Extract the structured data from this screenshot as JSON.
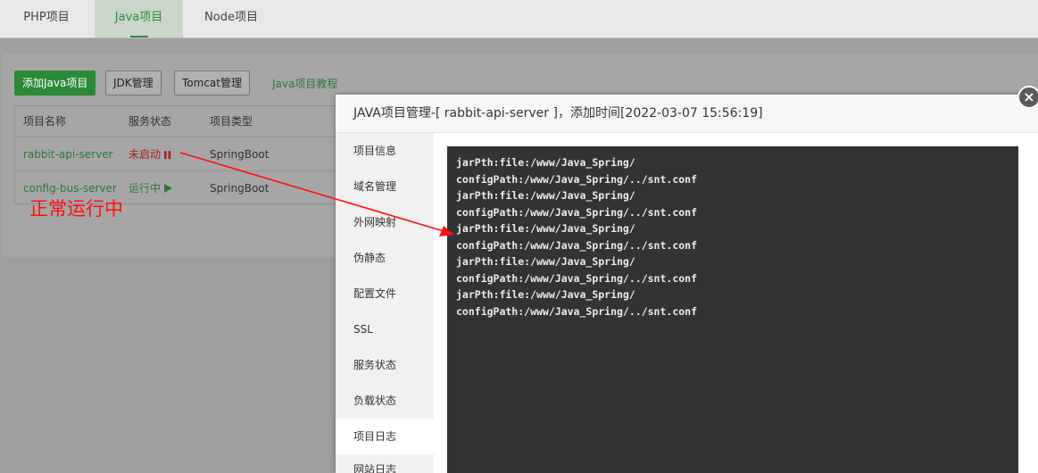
{
  "tabs": [
    {
      "label": "PHP项目"
    },
    {
      "label": "Java项目"
    },
    {
      "label": "Node项目"
    }
  ],
  "toolbar": {
    "add_label": "添加Java项目",
    "jdk_label": "JDK管理",
    "tomcat_label": "Tomcat管理",
    "tutorial_label": "Java项目教程"
  },
  "table": {
    "headers": [
      "项目名称",
      "服务状态",
      "项目类型"
    ],
    "rows": [
      {
        "name": "rabbit-api-server",
        "status": "未启动",
        "status_icon": "pause-icon",
        "type": "SpringBoot"
      },
      {
        "name": "config-bus-server",
        "status": "运行中",
        "status_icon": "play-icon",
        "type": "SpringBoot"
      }
    ]
  },
  "annotation": {
    "text": "正常运行中",
    "color": "#ff1010"
  },
  "modal": {
    "title": "JAVA项目管理-[ rabbit-api-server ]，添加时间[2022-03-07 15:56:19]",
    "menu": [
      "项目信息",
      "域名管理",
      "外网映射",
      "伪静态",
      "配置文件",
      "SSL",
      "服务状态",
      "负载状态",
      "项目日志",
      "网站日志"
    ],
    "active_menu": "项目日志",
    "log_lines": [
      "jarPth:file:/www/Java_Spring/",
      "configPath:/www/Java_Spring/../snt.conf",
      "jarPth:file:/www/Java_Spring/",
      "configPath:/www/Java_Spring/../snt.conf",
      "jarPth:file:/www/Java_Spring/",
      "configPath:/www/Java_Spring/../snt.conf",
      "jarPth:file:/www/Java_Spring/",
      "configPath:/www/Java_Spring/../snt.conf",
      "jarPth:file:/www/Java_Spring/",
      "configPath:/www/Java_Spring/../snt.conf"
    ],
    "close_icon": "close-icon"
  },
  "colors": {
    "accent": "#2a8a38",
    "stopped": "#a42222",
    "console_bg": "#333333",
    "overlay_bg": "#9f9f9f"
  }
}
